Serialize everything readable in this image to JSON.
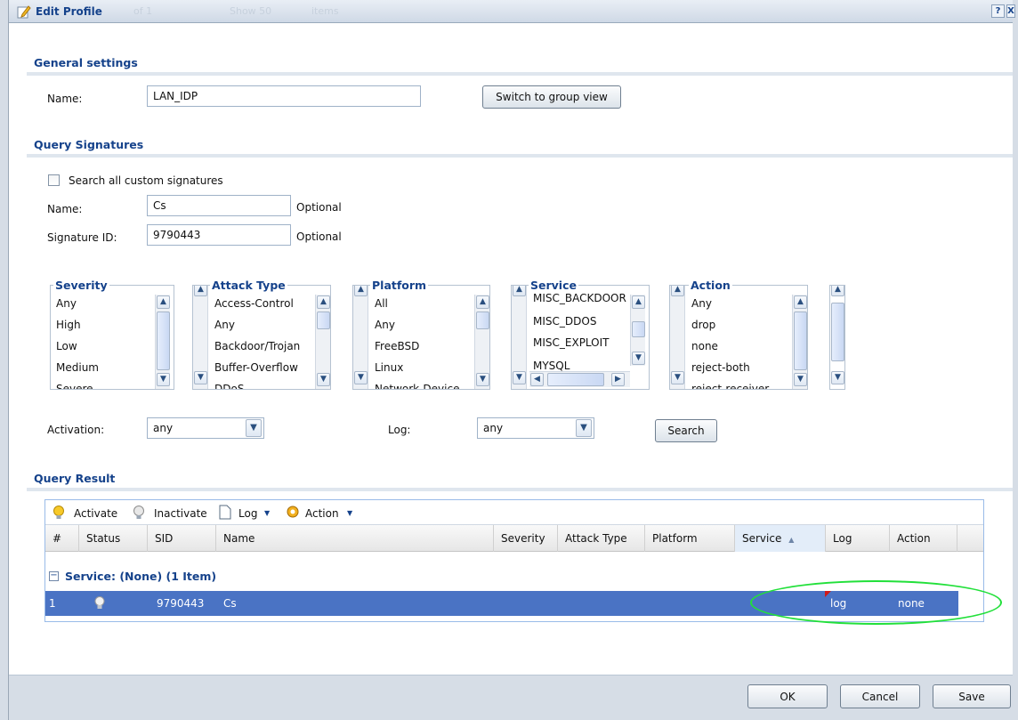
{
  "window": {
    "title": "Edit Profile",
    "ghost_text": [
      "of 1",
      "Show 50",
      "items"
    ],
    "help_label": "?",
    "close_label": "X"
  },
  "general_settings": {
    "title": "General settings",
    "name_label": "Name:",
    "name_value": "LAN_IDP",
    "switch_button": "Switch to group view"
  },
  "query_signatures": {
    "title": "Query Signatures",
    "search_all_label": "Search all custom signatures",
    "name_label": "Name:",
    "name_value": "Cs",
    "name_hint": "Optional",
    "sigid_label": "Signature ID:",
    "sigid_value": "9790443",
    "sigid_hint": "Optional",
    "severity": {
      "legend": "Severity",
      "items": [
        "Any",
        "High",
        "Low",
        "Medium",
        "Severe"
      ]
    },
    "attack_type": {
      "legend": "Attack Type",
      "items": [
        "Access-Control",
        "Any",
        "Backdoor/Trojan",
        "Buffer-Overflow",
        "DDoS"
      ]
    },
    "platform": {
      "legend": "Platform",
      "items": [
        "All",
        "Any",
        "FreeBSD",
        "Linux",
        "Network-Device"
      ]
    },
    "service": {
      "legend": "Service",
      "items": [
        "MISC_BACKDOOR",
        "MISC_DDOS",
        "MISC_EXPLOIT",
        "MYSQL"
      ]
    },
    "action": {
      "legend": "Action",
      "items": [
        "Any",
        "drop",
        "none",
        "reject-both",
        "reject-receiver"
      ]
    },
    "activation_label": "Activation:",
    "activation_value": "any",
    "log_label": "Log:",
    "log_value": "any",
    "search_button": "Search"
  },
  "query_result": {
    "title": "Query Result",
    "toolbar": {
      "activate": "Activate",
      "inactivate": "Inactivate",
      "log": "Log",
      "action": "Action"
    },
    "columns": [
      "#",
      "Status",
      "SID",
      "Name",
      "Severity",
      "Attack Type",
      "Platform",
      "Service",
      "Log",
      "Action"
    ],
    "sort_column": "Service",
    "group_title": "Service: (None) (1 Item)",
    "rows": [
      {
        "num": "1",
        "sid": "9790443",
        "name": "Cs",
        "log": "log",
        "action": "none"
      }
    ]
  },
  "footer": {
    "ok": "OK",
    "cancel": "Cancel",
    "save": "Save"
  },
  "colors": {
    "accent": "#15428b",
    "selected_row": "#4a73c4",
    "highlight_ellipse": "#22e03a"
  }
}
